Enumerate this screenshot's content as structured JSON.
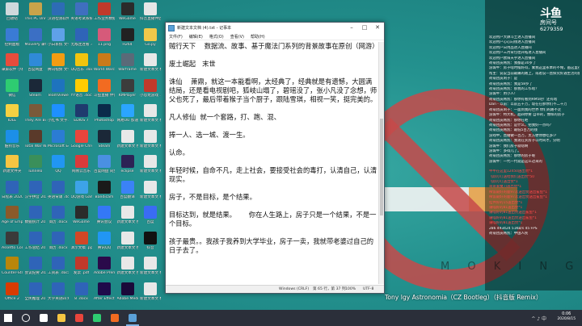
{
  "desktop": {
    "icons": [
      {
        "label": "回收站",
        "color": "#cfd8dc"
      },
      {
        "label": "This PC Universal...",
        "color": "#c9a34a"
      },
      {
        "label": "汉语检测软件",
        "color": "#2d6cb5"
      },
      {
        "label": "英语考试系统 .docx",
        "color": "#3f6fbf"
      },
      {
        "label": "工作业务数据 2020年...",
        "color": "#c0392b"
      },
      {
        "label": "WeGame",
        "color": "#2b2b2b"
      },
      {
        "label": "抖音直播伴侣",
        "color": "#e6e6e6"
      },
      {
        "label": "控制面板",
        "color": "#3a7bd5"
      },
      {
        "label": "MoviePy 录制",
        "color": "#3b6fc4"
      },
      {
        "label": "小白系统 文字...",
        "color": "#5fa1e8"
      },
      {
        "label": "无敌连连看 .docx",
        "color": "#2f64b8"
      },
      {
        "label": "11.png",
        "color": "#d65a7a"
      },
      {
        "label": "H264",
        "color": "#222222"
      },
      {
        "label": "Go.py",
        "color": "#f0c84a"
      },
      {
        "label": "录屏软件 小程序",
        "color": "#e74c3c"
      },
      {
        "label": "百度网盘",
        "color": "#2f8ad8"
      },
      {
        "label": "腾讯视频 文字...",
        "color": "#f39c12"
      },
      {
        "label": "QQ音乐 .docx",
        "color": "#f1c40f"
      },
      {
        "label": "World Warcraft",
        "color": "#c97a1a"
      },
      {
        "label": "Warframe",
        "color": "#5a6a78"
      },
      {
        "label": "新建文本文 档.txt",
        "color": "#e8e8e8"
      },
      {
        "label": "微信",
        "color": "#2ecc71"
      },
      {
        "label": "Steam",
        "color": "#1b2838"
      },
      {
        "label": "TeamViewer",
        "color": "#1e73be"
      },
      {
        "label": "YY语音 .docx",
        "color": "#ffcc00"
      },
      {
        "label": "斗鱼直播 伴侣",
        "color": "#f26b21"
      },
      {
        "label": "KMPlayer",
        "color": "#3c3c3c"
      },
      {
        "label": "小恐龙游戏 .exe",
        "color": "#c0392b"
      },
      {
        "label": "IDLE",
        "color": "#f5d142"
      },
      {
        "label": "They Are Billions",
        "color": "#7a5a3a"
      },
      {
        "label": "小红书 文字...",
        "color": "#1e90ff"
      },
      {
        "label": "EDIUS 7",
        "color": "#1f3a6e"
      },
      {
        "label": "Photoshop",
        "color": "#0a2a4a"
      },
      {
        "label": "网易UU 加速器",
        "color": "#2ba5ff"
      },
      {
        "label": "新建文本文 档.txt",
        "color": "#e8e8e8"
      },
      {
        "label": "酷狗音乐",
        "color": "#1c8fe8"
      },
      {
        "label": "Total War WARHAMMER",
        "color": "#5a3a2a"
      },
      {
        "label": "Microsoft Edge",
        "color": "#2b7cd3"
      },
      {
        "label": "Google Chrome",
        "color": "#e8453c"
      },
      {
        "label": "Steam",
        "color": "#1b2838"
      },
      {
        "label": "新建文本文 档.txt",
        "color": "#e8e8e8"
      },
      {
        "label": "新建文本文 档.txt",
        "color": "#e8e8e8"
      },
      {
        "label": "新建文件夹",
        "color": "#f5c542"
      },
      {
        "label": "Tunnelo",
        "color": "#3a8f5a"
      },
      {
        "label": "QQ",
        "color": "#2196f3"
      },
      {
        "label": "网易云音乐",
        "color": "#d93b3b"
      },
      {
        "label": "百度网盘 同步",
        "color": "#4a90e2"
      },
      {
        "label": "eclipse",
        "color": "#2c2255"
      },
      {
        "label": "新建文本文 档.txt",
        "color": "#e8e8e8"
      },
      {
        "label": "日程表 2020年 .docx",
        "color": "#2f64b8"
      },
      {
        "label": "汉字拼音 2020年 .docx",
        "color": "#2f64b8"
      },
      {
        "label": "英语背诵 .docx",
        "color": "#2f64b8"
      },
      {
        "label": "QQ游戏 Game",
        "color": "#3da3e8"
      },
      {
        "label": "Bandicam",
        "color": "#1a1a1a"
      },
      {
        "label": "百度翻译",
        "color": "#3b82f6"
      },
      {
        "label": "新建文本文 档.txt",
        "color": "#e8e8e8"
      },
      {
        "label": "Age of Empires II",
        "color": "#8a5a2a"
      },
      {
        "label": "数据统计 2019122...",
        "color": "#2f64b8"
      },
      {
        "label": "简历 .docx",
        "color": "#2f64b8"
      },
      {
        "label": "WeGame",
        "color": "#2b2b2b"
      },
      {
        "label": "腾讯会议",
        "color": "#3478f6"
      },
      {
        "label": "新建文本文 档(2)...",
        "color": "#e8e8e8"
      },
      {
        "label": "百度",
        "color": "#3a6cf4"
      },
      {
        "label": "Assetto Corsa",
        "color": "#3a3a3a"
      },
      {
        "label": "工作总结 2019122...",
        "color": "#2f64b8"
      },
      {
        "label": "简历 .docx",
        "color": "#2f64b8"
      },
      {
        "label": "演示文稿 .pptx",
        "color": "#d24726"
      },
      {
        "label": "腾讯QQ",
        "color": "#2196f3"
      },
      {
        "label": "新建文本文 档(3)...",
        "color": "#e8e8e8"
      },
      {
        "label": "抖音",
        "color": "#111111"
      },
      {
        "label": "Counter-Strike",
        "color": "#b8860b"
      },
      {
        "label": "会议纪要 2020021...",
        "color": "#2f64b8"
      },
      {
        "label": "工资表 .docx",
        "color": "#2f64b8"
      },
      {
        "label": "发票 .pdf",
        "color": "#c0392b"
      },
      {
        "label": "Adobe Premiere",
        "color": "#2a0a4a"
      },
      {
        "label": "新建文本文 档.txt",
        "color": "#e8e8e8"
      },
      {
        "label": "新建文本文 档(4)...",
        "color": "#e8e8e8"
      },
      {
        "label": "Office 2",
        "color": "#d83b01"
      },
      {
        "label": "全民推理 2019121...",
        "color": "#2f64b8"
      },
      {
        "label": "大学英语四 级.docx",
        "color": "#2f64b8"
      },
      {
        "label": "8 .docx",
        "color": "#2f64b8"
      },
      {
        "label": "After Effects CC",
        "color": "#1f0a4a"
      },
      {
        "label": "Adobe Media Encoder",
        "color": "#1a0a3a"
      },
      {
        "label": "新建文本文 档.txt",
        "color": "#e8e8e8"
      }
    ]
  },
  "notepad": {
    "title": "新建文本文档 (4).txt - 记事本",
    "menu": [
      "文件(F)",
      "编辑(E)",
      "格式(O)",
      "查看(V)",
      "帮助(H)"
    ],
    "paragraphs": [
      "贼行天下    数据流、故事、基于魔法门系列的背景故事在原创（网游）",
      "",
      "废土崛起   末世",
      "",
      "诛仙    萧鼎，就这一本能看啊，太经典了，经典就是有遗憾，大圆满结局，还是看电视剧吧，狐岐山塌了，碧瑶没了，张小凡没了念想，师父也死了，最后带着猴子当个厨子，跟陆雪琪，相视一笑，挺完美的。",
      "",
      "凡人修仙  就一个套路，打、跑、混、",
      "",
      "捧一人、选一城、渡一生。",
      "",
      "认命。",
      "",
      "年轻时候，自命不凡，走上社会，要接受社会的毒打，认清自己，认清现实。",
      "",
      "房子，不是目标，是个结果。",
      "",
      "目标达到，就是结果。      你在人生路上，房子只是一个结果，不是一个目标。",
      "",
      "孩子最贵。。我孩子我养到大学毕业，房子一卖，我就带老婆过自己的日子去了。"
    ],
    "status": {
      "eol": "Windows (CRLF)",
      "position": "第 65 行，第 37 列",
      "zoom": "100%",
      "encoding": "UTF-8"
    }
  },
  "stream": {
    "logo": "斗鱼",
    "room_label": "房间号",
    "room_id": "6279359",
    "chat": [
      "欢迎用户大肆斗土进入直播间",
      "欢迎用户心心向钱进入直播间",
      "欢迎用户日用品进入直播间",
      "欢迎用户三月背包往开拓进入直播间",
      "欢迎用户欧阳天宇进入直播间",
      "荷菊团员韩凯：我都是30岁了",
      "游城牛：房子啥时候好得，乘我这里永本的不俺，画这里在家，我就要了",
      "帮主：说说当前最痛的路上，或者说一直探究好遇生活的阻碍",
      "荷菊团员闲子：是",
      "荷菊团员韩凯：我是58岁了",
      "荷菊团员韩凯：那我的工作啥？",
      "游城牛：用小人！",
      "荷菊团员韩凯：那你有看到RM5吧！还有啥",
      "Dan - 以前：以前五千万，现在在那你们不二千万",
      "荷菊团员闲子：一面到我的世界 你们的路不走",
      "游城牛：特大机，超四你要 自带的，像样的房子",
      "荷菊团员韩凯：那你在吧",
      "荷菊团员韩凯：是什么，把我好一点吗？",
      "荷菊团员韩凯：最低5百万的钱",
      "游戏中，直播做一百万，太方便你想吃多少",
      "荷菊团员韩凯：我现在买房子以时间才，分明",
      "游城牛：我们房子就啥啊",
      "游城牛：多得几了。",
      "荷菊团员韩凯：那你的房子呢",
      "游城牛：一代一代就是这么过来的"
    ],
    "gifts": [
      "牛牛在这里12450送出赞*1",
      "飞跃叮叮送给我们送出赞*50",
      "飞跃叮叮送出赞*1",
      "哥哥爱魔刀送出赞*1",
      "稀饭最好的鹿97次送出赞送出鲨鱼*1",
      "稀饭最好的鹿97次送出赞送出鲨鱼*1",
      "挂件好的15送出赞*1",
      "蒲喵好的81送出赞*1",
      "蒲喵好的81送出赞送出鲨鱼*1",
      "蒲喵好的81送出赞送出鲨鱼*1",
      "蒲喵好的81送出赞*1"
    ],
    "footer": [
      "286 493424 51KB/s 45 FPS",
      "荷菊团员韩凯：中国人民"
    ],
    "song": "Tony Igy  Astronomia（CZ Bootleg）（抖音版 Remix）"
  },
  "taskbar": {
    "time": "0:06",
    "date": "2020/8/15",
    "apps": [
      {
        "name": "start",
        "color": "#ffffff"
      },
      {
        "name": "search",
        "color": "#ffffff"
      },
      {
        "name": "task-view",
        "color": "#ffffff"
      },
      {
        "name": "explorer",
        "color": "#f5c542"
      },
      {
        "name": "browser",
        "color": "#e8453c"
      },
      {
        "name": "wechat",
        "color": "#2ecc71"
      },
      {
        "name": "douyu",
        "color": "#f26b21"
      },
      {
        "name": "notepad",
        "color": "#5aa0d8"
      }
    ],
    "tray": "^ ♪ 中"
  },
  "watermark": "M O K I N G",
  "colors": {
    "accent": "#d93b3b",
    "gift": "#ff4b4b"
  }
}
